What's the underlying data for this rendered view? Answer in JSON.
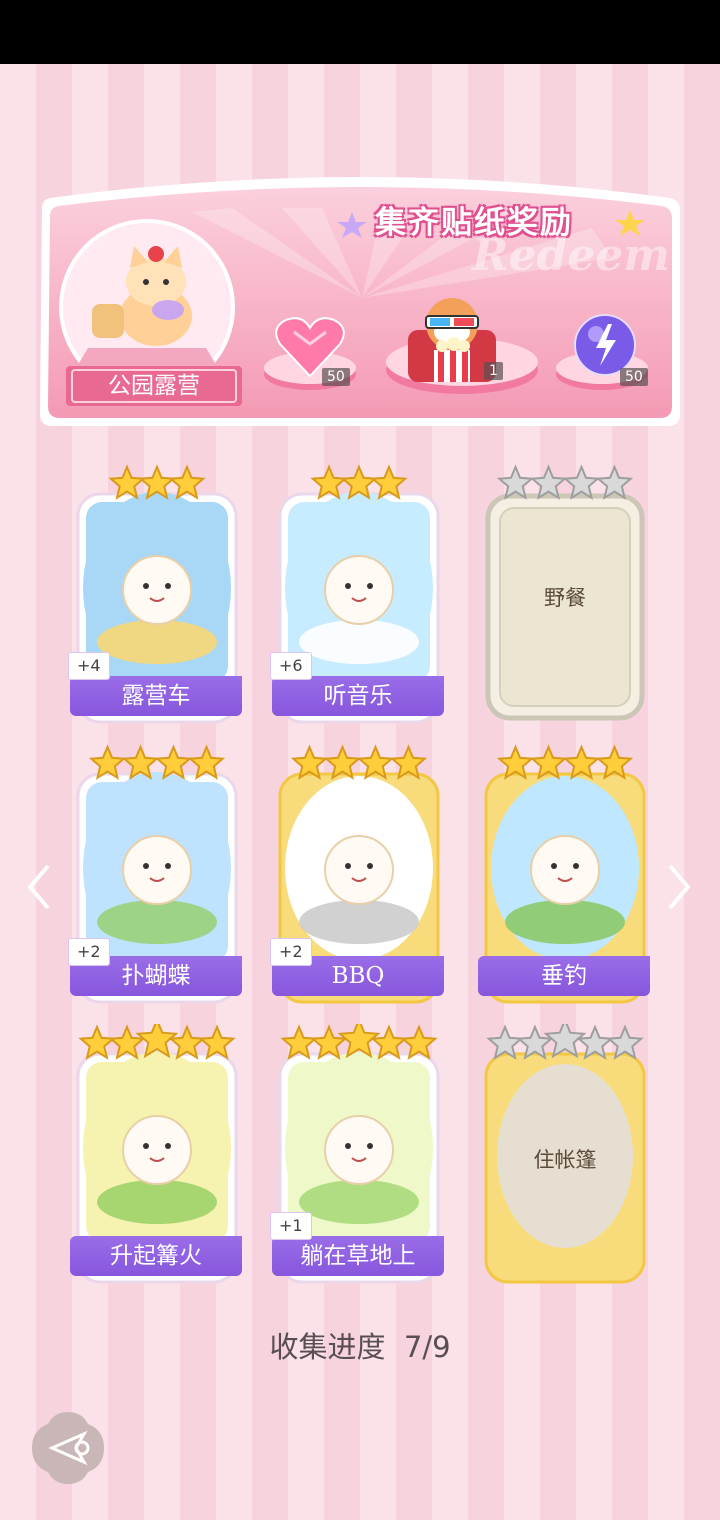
{
  "header": {
    "title": "集齐贴纸奖励",
    "watermark": "Redeem",
    "album_name": "公园露营",
    "rewards": [
      {
        "name": "heart-gem",
        "count": "50"
      },
      {
        "name": "popcorn-bear",
        "count": "1"
      },
      {
        "name": "purple-orb",
        "count": "50"
      }
    ]
  },
  "cards": [
    {
      "label": "露营车",
      "bonus": "+4",
      "stars": 3,
      "collected": true
    },
    {
      "label": "听音乐",
      "bonus": "+6",
      "stars": 3,
      "collected": true
    },
    {
      "label": "野餐",
      "bonus": "",
      "stars": 4,
      "collected": false
    },
    {
      "label": "扑蝴蝶",
      "bonus": "+2",
      "stars": 4,
      "collected": true
    },
    {
      "label": "BBQ",
      "bonus": "+2",
      "stars": 4,
      "collected": true,
      "gold": true
    },
    {
      "label": "垂钓",
      "bonus": "",
      "stars": 4,
      "collected": true,
      "gold": true
    },
    {
      "label": "升起篝火",
      "bonus": "",
      "stars": 5,
      "collected": true
    },
    {
      "label": "躺在草地上",
      "bonus": "+1",
      "stars": 5,
      "collected": true
    },
    {
      "label": "住帐篷",
      "bonus": "",
      "stars": 5,
      "collected": false,
      "gold": true
    }
  ],
  "progress": {
    "label": "收集进度",
    "value": "7/9"
  },
  "colors": {
    "accent": "#8b5ae0",
    "gold": "#f5c14a",
    "pink": "#f2a7bd"
  }
}
